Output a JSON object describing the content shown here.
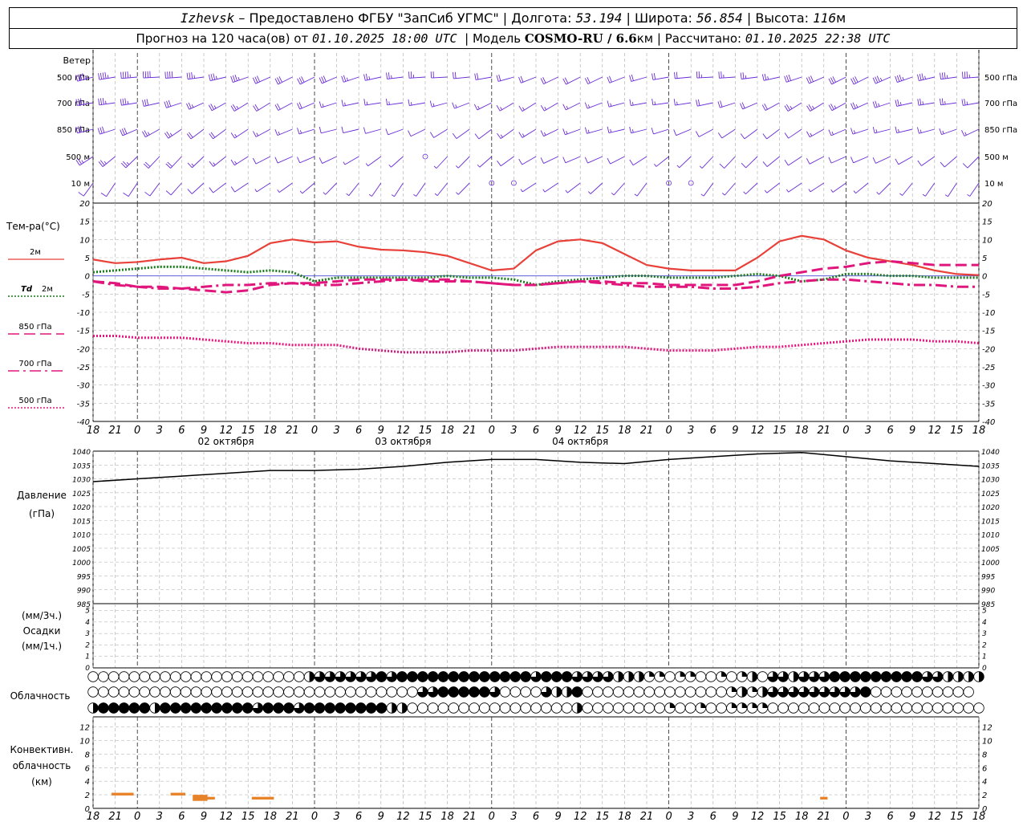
{
  "header": {
    "city": "Izhevsk",
    "provider": "– Предоставлено ФГБУ \"ЗапСиб УГМС\"",
    "lon_label": "Долгота:",
    "lon": "53.194",
    "lat_label": "Широта:",
    "lat": "56.854",
    "alt_label": "Высота:",
    "alt": "116",
    "alt_unit": "м",
    "fc_label": "Прогноз на 120 часа(ов) от",
    "fc_time": "01.10.2025 18:00 UTC",
    "model_label": "Модель",
    "model": "COSMO-RU / 6.6",
    "model_unit": "км",
    "calc_label": "Рассчитано:",
    "calc_time": "01.10.2025 22:38 UTC"
  },
  "labels": {
    "wind": "Ветер",
    "wind_levels": [
      "500 гПа",
      "700 гПа",
      "850 гПа",
      "500 м",
      "10 м"
    ],
    "temp_title": "Тем-ра(°С)",
    "legend": [
      {
        "name": "2м",
        "prefix": "",
        "color": "#e8413a",
        "style": "solid"
      },
      {
        "name": "2м",
        "prefix": "Td",
        "color": "#1a7a1a",
        "style": "dot"
      },
      {
        "name": "850 гПа",
        "prefix": "",
        "color": "#e0167d",
        "style": "dash"
      },
      {
        "name": "700 гПа",
        "prefix": "",
        "color": "#e0167d",
        "style": "dashdot"
      },
      {
        "name": "500 гПа",
        "prefix": "",
        "color": "#e0167d",
        "style": "dot"
      }
    ],
    "pressure": [
      "Давление",
      "(гПа)"
    ],
    "precip": [
      "(мм/3ч.)",
      "Осадки",
      "(мм/1ч.)"
    ],
    "cloud": "Облачность",
    "conv": [
      "Конвективн.",
      "облачность",
      "(км)"
    ]
  },
  "chart_data": [
    {
      "type": "line",
      "title": "Тем-ра(°С)",
      "x": [
        0,
        3,
        6,
        9,
        12,
        15,
        18,
        21,
        24,
        27,
        30,
        33,
        36,
        39,
        42,
        45,
        48,
        51,
        54,
        57,
        60,
        63,
        66,
        69,
        72,
        75,
        78,
        81,
        84,
        87,
        90,
        93,
        96,
        99,
        102,
        105,
        108,
        111,
        114,
        117,
        120
      ],
      "x_tick_labels": [
        "18",
        "21",
        "0",
        "3",
        "6",
        "9",
        "12",
        "15",
        "18",
        "21",
        "0",
        "3",
        "6",
        "9",
        "12",
        "15",
        "18",
        "21",
        "0",
        "3",
        "6",
        "9",
        "12",
        "15",
        "18",
        "21",
        "0",
        "3",
        "6",
        "9",
        "12",
        "15",
        "18",
        "21",
        "0",
        "3",
        "6",
        "9",
        "12",
        "15",
        "18",
        "21",
        "0"
      ],
      "date_labels": [
        "02 октября",
        "03 октября",
        "04 октября"
      ],
      "ylim": [
        -40,
        20
      ],
      "y_ticks": [
        20,
        15,
        10,
        5,
        0,
        -5,
        -10,
        -15,
        -20,
        -25,
        -30,
        -35,
        -40
      ],
      "series": [
        {
          "name": "2м",
          "values": [
            4.5,
            3.5,
            3.8,
            4.5,
            5.0,
            3.5,
            4.0,
            5.5,
            9.0,
            10.0,
            9.2,
            9.5,
            8.0,
            7.2,
            7.0,
            6.5,
            5.5,
            3.5,
            1.5,
            2.0,
            7.0,
            9.5,
            10.0,
            9.0,
            6.0,
            3.0,
            2.0,
            1.5,
            1.5,
            1.5,
            5.0,
            9.5,
            11.0,
            10.0,
            7.0,
            5.0,
            4.0,
            3.0,
            1.5,
            0.5,
            0.2
          ]
        },
        {
          "name": "Td 2м",
          "values": [
            1.0,
            1.5,
            2.0,
            2.5,
            2.5,
            2.0,
            1.5,
            1.0,
            1.5,
            1.0,
            -1.5,
            -0.5,
            -0.5,
            -0.5,
            -0.5,
            -0.5,
            0.0,
            -0.5,
            -0.5,
            -1.0,
            -2.5,
            -1.5,
            -1.0,
            -0.5,
            0.0,
            0.0,
            -0.5,
            -0.5,
            -0.5,
            0.0,
            0.5,
            0.0,
            -1.5,
            -1.0,
            0.5,
            0.5,
            0.0,
            0.0,
            -0.5,
            -0.5,
            -0.5
          ]
        },
        {
          "name": "850 гПа",
          "values": [
            -1.5,
            -2.0,
            -3.0,
            -3.0,
            -3.5,
            -4.0,
            -4.5,
            -4.0,
            -2.5,
            -2.0,
            -2.0,
            -1.5,
            -1.0,
            -1.0,
            -1.0,
            -1.5,
            -1.5,
            -1.5,
            -2.0,
            -2.5,
            -2.5,
            -2.0,
            -1.5,
            -1.5,
            -2.0,
            -2.0,
            -2.5,
            -2.5,
            -2.5,
            -2.5,
            -1.5,
            0.0,
            1.0,
            2.0,
            2.5,
            3.5,
            4.0,
            3.5,
            3.0,
            3.0,
            3.0
          ]
        },
        {
          "name": "700 гПа",
          "values": [
            -1.5,
            -2.5,
            -3.0,
            -3.5,
            -3.5,
            -3.0,
            -2.5,
            -2.5,
            -2.0,
            -2.0,
            -2.5,
            -2.5,
            -2.0,
            -1.5,
            -1.0,
            -1.0,
            -1.0,
            -1.5,
            -2.0,
            -2.5,
            -2.5,
            -2.0,
            -1.5,
            -2.0,
            -2.5,
            -3.0,
            -3.0,
            -3.0,
            -3.5,
            -3.5,
            -3.0,
            -2.0,
            -1.5,
            -1.0,
            -1.0,
            -1.5,
            -2.0,
            -2.5,
            -2.5,
            -3.0,
            -3.0
          ]
        },
        {
          "name": "500 гПа",
          "values": [
            -16.5,
            -16.5,
            -17.0,
            -17.0,
            -17.0,
            -17.5,
            -18.0,
            -18.5,
            -18.5,
            -19.0,
            -19.0,
            -19.0,
            -20.0,
            -20.5,
            -21.0,
            -21.0,
            -21.0,
            -20.5,
            -20.5,
            -20.5,
            -20.0,
            -19.5,
            -19.5,
            -19.5,
            -19.5,
            -20.0,
            -20.5,
            -20.5,
            -20.5,
            -20.0,
            -19.5,
            -19.5,
            -19.0,
            -18.5,
            -18.0,
            -17.5,
            -17.5,
            -17.5,
            -18.0,
            -18.0,
            -18.5
          ]
        }
      ]
    },
    {
      "type": "line",
      "title": "Давление",
      "ylabel": "(гПа)",
      "x": [
        0,
        6,
        12,
        18,
        24,
        30,
        36,
        42,
        48,
        54,
        60,
        66,
        72,
        78,
        84,
        90,
        96,
        102,
        108,
        114,
        120
      ],
      "ylim": [
        985,
        1040
      ],
      "y_ticks": [
        1040,
        1035,
        1030,
        1025,
        1020,
        1015,
        1010,
        1005,
        1000,
        995,
        990,
        985
      ],
      "series": [
        {
          "name": "Давление",
          "values": [
            1029,
            1030,
            1031,
            1032,
            1033,
            1033,
            1033.5,
            1034.5,
            1036,
            1037,
            1037,
            1036,
            1035.5,
            1037,
            1038,
            1039,
            1039.5,
            1038,
            1036.5,
            1035.5,
            1034.5
          ]
        }
      ]
    },
    {
      "type": "bar",
      "title": "Осадки",
      "ylabel": "(мм/3ч.)",
      "ylim": [
        0,
        5
      ],
      "y_ticks": [
        5,
        4,
        3,
        2,
        1,
        0
      ],
      "values": []
    },
    {
      "type": "table",
      "title": "Облачность",
      "note": "cloud cover fraction in eighths per level (high, middle, low)",
      "rows": [
        [
          0,
          0,
          0,
          0,
          0,
          0,
          0,
          0,
          0,
          0,
          0,
          0,
          0,
          0,
          0,
          0,
          0,
          0,
          0,
          0,
          0,
          4,
          6,
          6,
          6,
          6,
          6,
          6,
          8,
          6,
          8,
          8,
          8,
          8,
          8,
          8,
          8,
          8,
          8,
          8,
          8,
          8,
          8,
          6,
          8,
          8,
          8,
          6,
          6,
          6,
          6,
          4,
          4,
          4,
          2,
          2,
          0,
          2,
          2,
          0,
          0,
          2,
          0,
          2,
          4,
          0,
          6,
          6,
          4,
          6,
          6,
          6,
          8,
          8,
          8,
          8,
          8,
          8,
          8,
          8,
          8,
          6,
          6,
          4,
          4,
          4,
          4
        ],
        [
          0,
          0,
          0,
          0,
          0,
          0,
          0,
          0,
          0,
          0,
          0,
          0,
          0,
          0,
          0,
          0,
          0,
          0,
          0,
          0,
          0,
          0,
          0,
          0,
          0,
          0,
          0,
          0,
          0,
          0,
          0,
          0,
          6,
          6,
          8,
          8,
          8,
          8,
          8,
          6,
          0,
          0,
          0,
          0,
          6,
          4,
          4,
          8,
          0,
          0,
          0,
          0,
          0,
          0,
          0,
          0,
          0,
          0,
          0,
          0,
          0,
          0,
          2,
          4,
          2,
          4,
          6,
          6,
          6,
          6,
          6,
          6,
          6,
          6,
          6,
          8,
          0,
          0,
          0,
          0,
          0,
          0,
          0,
          0,
          0,
          0
        ],
        [
          4,
          8,
          8,
          8,
          8,
          8,
          4,
          8,
          8,
          8,
          8,
          8,
          8,
          8,
          8,
          8,
          6,
          8,
          8,
          8,
          6,
          8,
          8,
          8,
          8,
          8,
          8,
          8,
          8,
          4,
          4,
          0,
          0,
          0,
          0,
          0,
          0,
          0,
          0,
          0,
          0,
          0,
          0,
          0,
          0,
          0,
          0,
          4,
          0,
          0,
          0,
          0,
          0,
          0,
          0,
          0,
          2,
          0,
          0,
          2,
          0,
          0,
          2,
          2,
          2,
          2,
          0,
          0,
          0,
          0,
          0,
          0,
          0,
          0,
          0,
          0,
          0,
          0,
          0,
          0,
          0,
          0,
          0,
          0,
          0,
          0,
          0
        ]
      ]
    },
    {
      "type": "bar",
      "title": "Конвективн. облачность",
      "ylabel": "(км)",
      "ylim": [
        0,
        13
      ],
      "y_ticks": [
        12,
        10,
        8,
        6,
        4,
        2,
        0
      ],
      "bars": [
        {
          "x0": 2.5,
          "x1": 5.5,
          "base": 1.9,
          "top": 2.3
        },
        {
          "x0": 10.5,
          "x1": 12.5,
          "base": 1.9,
          "top": 2.3
        },
        {
          "x0": 13.5,
          "x1": 15.5,
          "base": 1.1,
          "top": 2.0
        },
        {
          "x0": 14.5,
          "x1": 16.5,
          "base": 1.3,
          "top": 1.7
        },
        {
          "x0": 21.5,
          "x1": 24.5,
          "base": 1.3,
          "top": 1.7
        },
        {
          "x0": 98.5,
          "x1": 99.5,
          "base": 1.3,
          "top": 1.7
        }
      ]
    }
  ],
  "wind_barbs": {
    "levels": [
      "500 гПа",
      "700 гПа",
      "850 гПа",
      "500 м",
      "10 м"
    ],
    "colors": [
      "#6a2bd8",
      "#6a2bd8",
      "#6a2bd8",
      "#6a2bd8",
      "#6a2bd8"
    ],
    "speed_kt": [
      [
        45,
        45,
        45,
        40,
        40,
        35,
        35,
        35,
        30,
        30,
        30,
        30,
        25,
        25,
        25,
        25,
        20,
        20,
        20,
        20,
        20,
        20,
        20,
        20,
        20,
        20,
        20,
        20,
        25,
        25,
        25,
        25,
        30,
        30,
        30,
        30,
        35,
        35,
        35,
        35,
        35
      ],
      [
        35,
        35,
        35,
        30,
        30,
        25,
        25,
        25,
        20,
        20,
        20,
        15,
        15,
        15,
        15,
        15,
        15,
        15,
        15,
        15,
        15,
        15,
        15,
        15,
        15,
        15,
        15,
        15,
        20,
        20,
        20,
        20,
        25,
        25,
        25,
        25,
        25,
        25,
        25,
        25,
        25
      ],
      [
        30,
        30,
        30,
        25,
        25,
        20,
        20,
        15,
        15,
        15,
        15,
        10,
        10,
        10,
        10,
        10,
        10,
        10,
        10,
        15,
        15,
        15,
        15,
        15,
        15,
        15,
        10,
        10,
        10,
        10,
        10,
        10,
        10,
        15,
        15,
        15,
        15,
        15,
        15,
        15,
        15
      ],
      [
        25,
        25,
        25,
        20,
        20,
        15,
        15,
        15,
        10,
        10,
        10,
        10,
        5,
        5,
        5,
        0,
        5,
        5,
        5,
        10,
        10,
        10,
        10,
        10,
        10,
        10,
        5,
        5,
        5,
        10,
        10,
        10,
        10,
        10,
        10,
        10,
        10,
        10,
        10,
        10,
        10
      ],
      [
        10,
        10,
        10,
        10,
        10,
        10,
        10,
        10,
        5,
        5,
        5,
        5,
        5,
        5,
        5,
        5,
        5,
        5,
        0,
        0,
        5,
        5,
        5,
        5,
        5,
        5,
        0,
        0,
        5,
        5,
        5,
        5,
        5,
        5,
        5,
        5,
        5,
        5,
        5,
        5,
        5
      ]
    ]
  }
}
